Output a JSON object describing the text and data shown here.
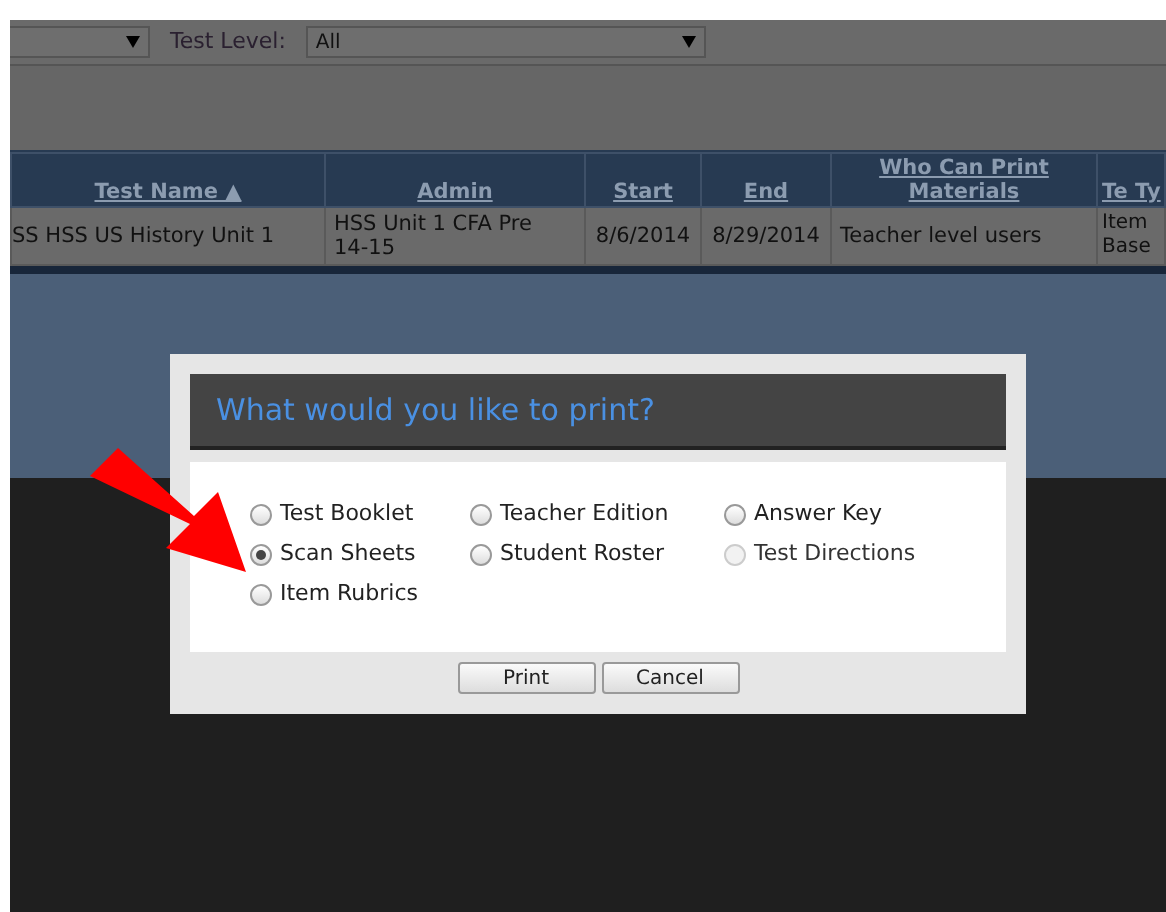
{
  "filters": [
    {
      "label": "Test Level:",
      "value": "All"
    }
  ],
  "table": {
    "columns": [
      {
        "label": "Test Name ▲"
      },
      {
        "label": "Admin"
      },
      {
        "label": "Start"
      },
      {
        "label": "End"
      },
      {
        "label": "Who Can Print Materials"
      },
      {
        "label": "Te Ty"
      }
    ],
    "rows": [
      [
        "SS HSS US History Unit 1",
        "HSS Unit 1 CFA Pre 14-15",
        "8/6/2014",
        "8/29/2014",
        "Teacher level users",
        "Item Base"
      ]
    ]
  },
  "dialog": {
    "title": "What would you like to print?",
    "options": [
      {
        "label": "Test Booklet",
        "selected": false,
        "disabled": false
      },
      {
        "label": "Teacher Edition",
        "selected": false,
        "disabled": false
      },
      {
        "label": "Answer Key",
        "selected": false,
        "disabled": false
      },
      {
        "label": "Scan Sheets",
        "selected": true,
        "disabled": false
      },
      {
        "label": "Student Roster",
        "selected": false,
        "disabled": false
      },
      {
        "label": "Test Directions",
        "selected": false,
        "disabled": true
      },
      {
        "label": "Item Rubrics",
        "selected": false,
        "disabled": false
      }
    ],
    "buttons": [
      "Print",
      "Cancel"
    ]
  }
}
